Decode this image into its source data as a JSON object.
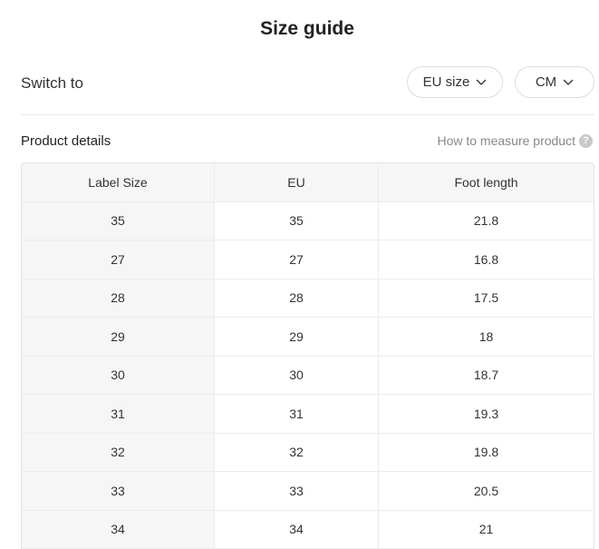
{
  "title": "Size guide",
  "switch": {
    "label": "Switch to",
    "size_system": "EU size",
    "unit": "CM"
  },
  "details": {
    "label": "Product details",
    "how_to_measure": "How to measure product",
    "help_glyph": "?"
  },
  "table": {
    "headers": [
      "Label Size",
      "EU",
      "Foot length"
    ],
    "rows": [
      [
        "35",
        "35",
        "21.8"
      ],
      [
        "27",
        "27",
        "16.8"
      ],
      [
        "28",
        "28",
        "17.5"
      ],
      [
        "29",
        "29",
        "18"
      ],
      [
        "30",
        "30",
        "18.7"
      ],
      [
        "31",
        "31",
        "19.3"
      ],
      [
        "32",
        "32",
        "19.8"
      ],
      [
        "33",
        "33",
        "20.5"
      ],
      [
        "34",
        "34",
        "21"
      ]
    ]
  },
  "icons": {
    "dropdown": "chevron-down-icon",
    "help": "question-circle-icon"
  },
  "colors": {
    "header_bg": "#f6f6f6",
    "border": "#ececec",
    "muted_text": "#888888"
  }
}
